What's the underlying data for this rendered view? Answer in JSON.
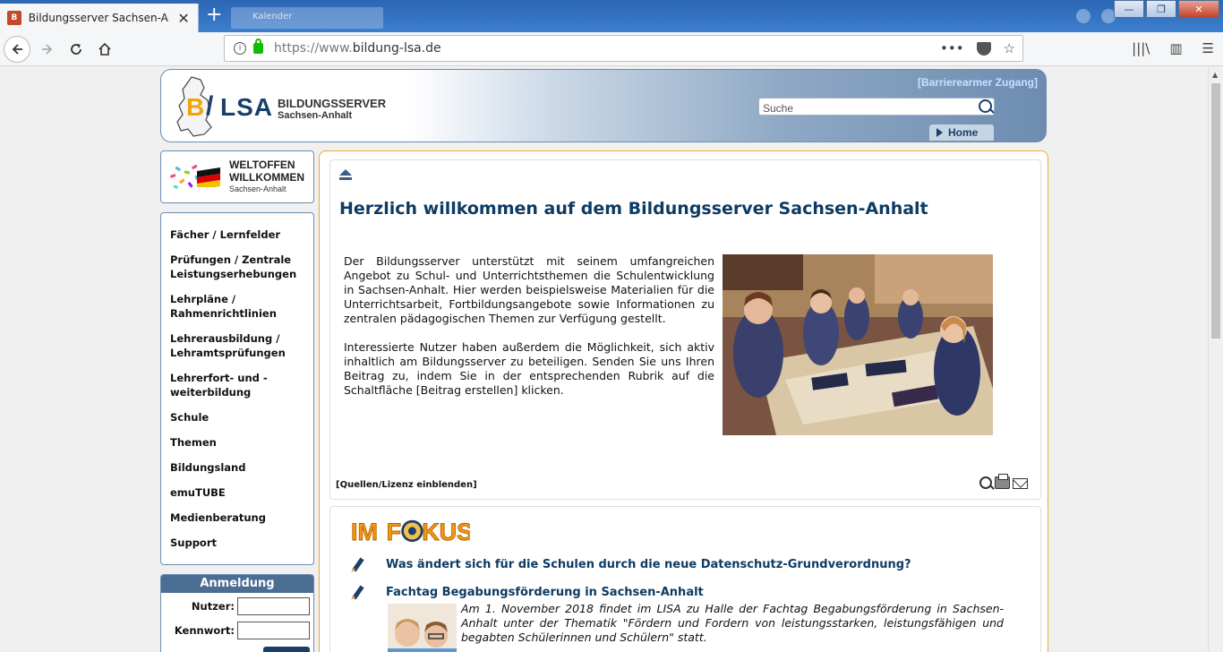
{
  "browser": {
    "tab_title": "Bildungsserver Sachsen-Anhalt",
    "ghost_tab_title": "Kalender",
    "new_tab_symbol": "+",
    "close_symbol": "✕",
    "window_minimize": "—",
    "window_maximize": "❐",
    "window_close": "✕",
    "url_scheme": "https://www.",
    "url_host": "bildung-lsa.de",
    "icons": [
      "back-icon",
      "forward-icon",
      "reload-icon",
      "home-icon",
      "info-icon",
      "lock-icon",
      "page-actions-icon",
      "pocket-icon",
      "bookmark-star-icon",
      "library-icon",
      "sidebar-icon",
      "menu-icon"
    ],
    "page_actions_label": "•••",
    "bookmark_label": "☆",
    "library_label": "|||\\",
    "sidebar_label": "▥",
    "menu_label": "☰"
  },
  "header": {
    "logo_b": "B",
    "logo_slash": "/",
    "logo_lsa": "LSA",
    "logo_title": "BILDUNGSSERVER",
    "logo_sub": "Sachsen-Anhalt",
    "barrier_link": "[Barrierearmer Zugang]",
    "search_placeholder": "Suche",
    "home_label": "Home",
    "accent_color": "#1a3f6b",
    "logo_orange": "#f0a30a"
  },
  "weltoffen": {
    "title1": "WELTOFFEN",
    "title2": "WILLKOMMEN",
    "sub": "Sachsen-Anhalt"
  },
  "leftnav": {
    "items": [
      {
        "label": "Fächer / Lernfelder"
      },
      {
        "label": "Prüfungen / Zentrale Leistungserhebungen"
      },
      {
        "label": "Lehrpläne / Rahmenrichtlinien"
      },
      {
        "label": "Lehrerausbildung / Lehramtsprüfungen"
      },
      {
        "label": "Lehrerfort- und -weiterbildung"
      },
      {
        "label": "Schule"
      },
      {
        "label": "Themen"
      },
      {
        "label": "Bildungsland"
      },
      {
        "label": "emuTUBE"
      },
      {
        "label": "Medienberatung"
      },
      {
        "label": "Support"
      }
    ]
  },
  "login": {
    "heading": "Anmeldung",
    "user_label": "Nutzer:",
    "password_label": "Kennwort:",
    "user_value": "",
    "password_value": ""
  },
  "welcome": {
    "title": "Herzlich willkommen auf dem Bildungsserver Sachsen-Anhalt",
    "paragraph1": "Der Bildungsserver unterstützt mit seinem umfangreichen Angebot zu Schul- und Unterrichtsthemen die Schulentwicklung in Sachsen-Anhalt. Hier werden beispielsweise Materialien für die Unterrichtsarbeit, Fortbildungsangebote sowie Informationen zu zentralen pädagogischen Themen zur Verfügung gestellt.",
    "paragraph2": "Interessierte Nutzer haben außerdem die Möglichkeit, sich aktiv inhaltlich am Bildungsserver zu beteiligen. Senden Sie uns Ihren Beitrag zu, indem Sie in der entsprechenden Rubrik auf die Schaltfläche [Beitrag erstellen] klicken.",
    "quellen_link": "[Quellen/Lizenz einblenden]"
  },
  "fokus": {
    "logo_im": "IM",
    "logo_f": "F",
    "logo_kus": "KUS",
    "items": [
      {
        "title": "Was ändert sich für die Schulen durch die neue Datenschutz-Grundverordnung?",
        "text": ""
      },
      {
        "title": "Fachtag Begabungsförderung in Sachsen-Anhalt",
        "text": "Am 1. November 2018 findet im LISA zu Halle der Fachtag Begabungsförderung in Sachsen-Anhalt unter der Thematik \"Fördern und Fordern von leistungsstarken, leistungsfähigen und begabten Schülerinnen und Schülern\" statt."
      }
    ]
  }
}
